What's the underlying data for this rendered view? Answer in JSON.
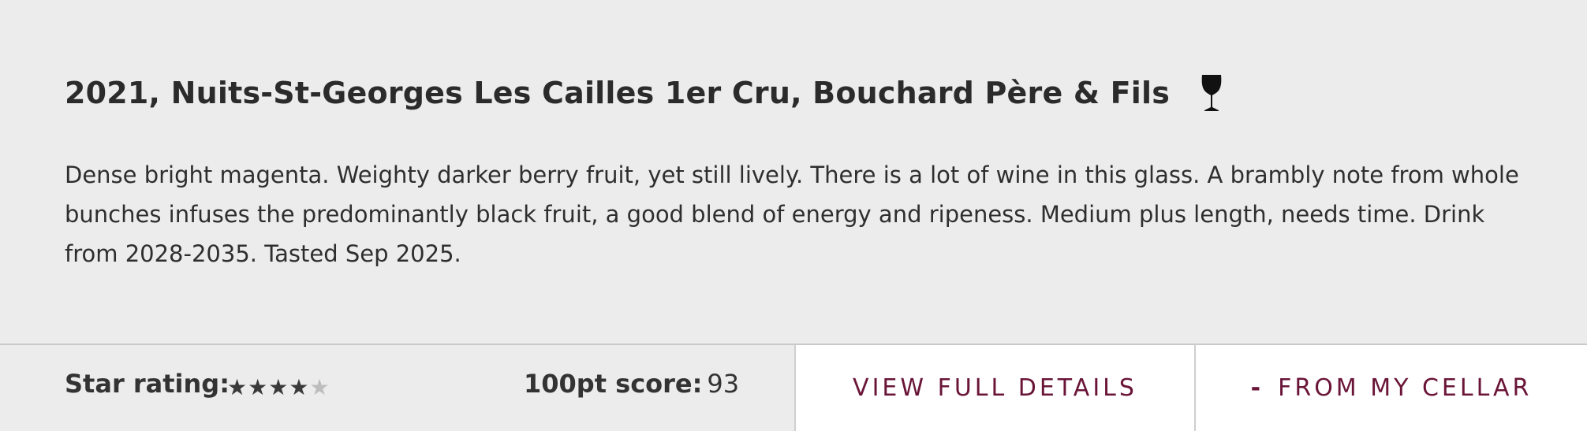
{
  "wine": {
    "title": "2021, Nuits-St-Georges Les Cailles 1er Cru, Bouchard Père & Fils",
    "icon": "wine-glass-icon",
    "tasting_note": "Dense bright magenta. Weighty darker berry fruit, yet still lively. There is a lot of wine in this glass. A brambly note from whole bunches infuses the predominantly black fruit, a good blend of energy and ripeness. Medium plus length, needs time. Drink from 2028-2035. Tasted Sep 2025."
  },
  "rating": {
    "star_label": "Star rating:",
    "stars_filled": 4,
    "stars_total": 5,
    "score_label": "100pt score:",
    "score_value": "93"
  },
  "actions": {
    "view_details_label": "VIEW FULL DETAILS",
    "cellar_icon": "-",
    "cellar_label": "FROM MY CELLAR"
  },
  "colors": {
    "background": "#ececec",
    "accent": "#6a1538",
    "star_filled": "#3a3a3a",
    "star_empty": "#bdbdbd"
  }
}
